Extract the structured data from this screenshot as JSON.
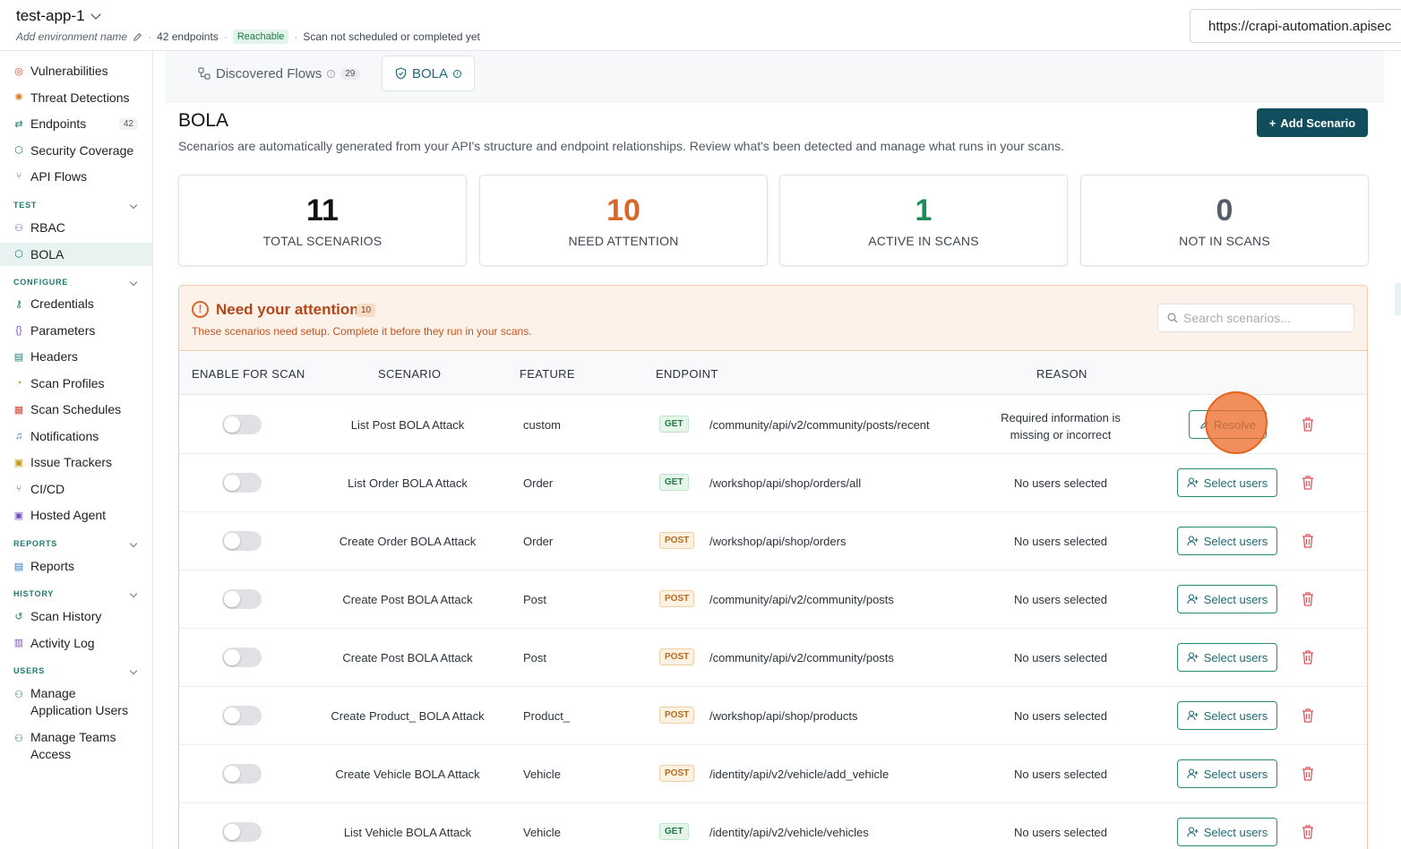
{
  "header": {
    "app_name": "test-app-1",
    "env_name_placeholder": "Add environment name",
    "endpoints": "42 endpoints",
    "reachable": "Reachable",
    "scan_status": "Scan not scheduled or completed yet",
    "url": "https://crapi-automation.apisec"
  },
  "sidebar": {
    "analyze_items": [
      {
        "label": "Vulnerabilities",
        "icon": "shield-alert-icon",
        "color": "#d8453a"
      },
      {
        "label": "Threat Detections",
        "icon": "radar-icon",
        "color": "#e07b2a"
      },
      {
        "label": "Endpoints",
        "icon": "endpoints-icon",
        "color": "#1c7a6e",
        "count": "42"
      },
      {
        "label": "Security Coverage",
        "icon": "shield-icon",
        "color": "#1c7a6e"
      },
      {
        "label": "API Flows",
        "icon": "flow-icon",
        "color": "#7a4fc4"
      }
    ],
    "test_section": "TEST",
    "test_items": [
      {
        "label": "RBAC",
        "icon": "users-icon",
        "color": "#7a4fc4"
      },
      {
        "label": "BOLA",
        "icon": "shield-check-icon",
        "color": "#1c7a6e"
      }
    ],
    "configure_section": "CONFIGURE",
    "configure_items": [
      {
        "label": "Credentials",
        "icon": "key-icon",
        "color": "#1c7a6e"
      },
      {
        "label": "Parameters",
        "icon": "braces-icon",
        "color": "#7a4fc4"
      },
      {
        "label": "Headers",
        "icon": "table-icon",
        "color": "#1c7a6e"
      },
      {
        "label": "Scan Profiles",
        "icon": "gauge-icon",
        "color": "#e07b2a"
      },
      {
        "label": "Scan Schedules",
        "icon": "calendar-icon",
        "color": "#d8453a"
      },
      {
        "label": "Notifications",
        "icon": "bell-icon",
        "color": "#2a7ac4"
      },
      {
        "label": "Issue Trackers",
        "icon": "tracker-icon",
        "color": "#c49a1a"
      },
      {
        "label": "CI/CD",
        "icon": "pipeline-icon",
        "color": "#2a7ac4"
      },
      {
        "label": "Hosted Agent",
        "icon": "agent-icon",
        "color": "#7a4fc4"
      }
    ],
    "reports_section": "REPORTS",
    "reports_items": [
      {
        "label": "Reports",
        "icon": "report-icon",
        "color": "#2a7ac4"
      }
    ],
    "history_section": "HISTORY",
    "history_items": [
      {
        "label": "Scan History",
        "icon": "history-icon",
        "color": "#1c7a6e"
      },
      {
        "label": "Activity Log",
        "icon": "log-icon",
        "color": "#7a4fc4"
      }
    ],
    "users_section": "USERS",
    "users_items": [
      {
        "label": "Manage Application Users",
        "icon": "user-icon",
        "color": "#1c7a6e"
      },
      {
        "label": "Manage Teams Access",
        "icon": "team-icon",
        "color": "#1c7a6e"
      }
    ]
  },
  "tabs": {
    "discovered": "Discovered Flows",
    "discovered_count": "29",
    "bola": "BOLA"
  },
  "page": {
    "title": "BOLA",
    "subtitle": "Scenarios are automatically generated from your API's structure and endpoint relationships. Review what's been detected and manage what runs in your scans.",
    "add_button": "Add Scenario"
  },
  "stats": [
    {
      "value": "11",
      "label": "TOTAL SCENARIOS",
      "color": "#111111"
    },
    {
      "value": "10",
      "label": "NEED ATTENTION",
      "color": "#d9662a"
    },
    {
      "value": "1",
      "label": "ACTIVE IN SCANS",
      "color": "#1e8a5a"
    },
    {
      "value": "0",
      "label": "NOT IN SCANS",
      "color": "#555e68"
    }
  ],
  "attention": {
    "title": "Need your attention",
    "count": "10",
    "subtitle": "These scenarios need setup. Complete it before they run in your scans.",
    "search_placeholder": "Search scenarios..."
  },
  "table": {
    "headers": {
      "enable": "ENABLE FOR SCAN",
      "scenario": "SCENARIO",
      "feature": "FEATURE",
      "endpoint": "ENDPOINT",
      "reason": "REASON"
    },
    "rows": [
      {
        "scenario": "List Post BOLA Attack",
        "feature": "custom",
        "method": "GET",
        "path": "/community/api/v2/community/posts/recent",
        "reason": "Required information is missing or incorrect",
        "action": "Resolve"
      },
      {
        "scenario": "List Order BOLA Attack",
        "feature": "Order",
        "method": "GET",
        "path": "/workshop/api/shop/orders/all",
        "reason": "No users selected",
        "action": "Select users"
      },
      {
        "scenario": "Create Order BOLA Attack",
        "feature": "Order",
        "method": "POST",
        "path": "/workshop/api/shop/orders",
        "reason": "No users selected",
        "action": "Select users"
      },
      {
        "scenario": "Create Post BOLA Attack",
        "feature": "Post",
        "method": "POST",
        "path": "/community/api/v2/community/posts",
        "reason": "No users selected",
        "action": "Select users"
      },
      {
        "scenario": "Create Post BOLA Attack",
        "feature": "Post",
        "method": "POST",
        "path": "/community/api/v2/community/posts",
        "reason": "No users selected",
        "action": "Select users"
      },
      {
        "scenario": "Create Product_ BOLA Attack",
        "feature": "Product_",
        "method": "POST",
        "path": "/workshop/api/shop/products",
        "reason": "No users selected",
        "action": "Select users"
      },
      {
        "scenario": "Create Vehicle BOLA Attack",
        "feature": "Vehicle",
        "method": "POST",
        "path": "/identity/api/v2/vehicle/add_vehicle",
        "reason": "No users selected",
        "action": "Select users"
      },
      {
        "scenario": "List Vehicle BOLA Attack",
        "feature": "Vehicle",
        "method": "GET",
        "path": "/identity/api/v2/vehicle/vehicles",
        "reason": "No users selected",
        "action": "Select users"
      }
    ]
  }
}
